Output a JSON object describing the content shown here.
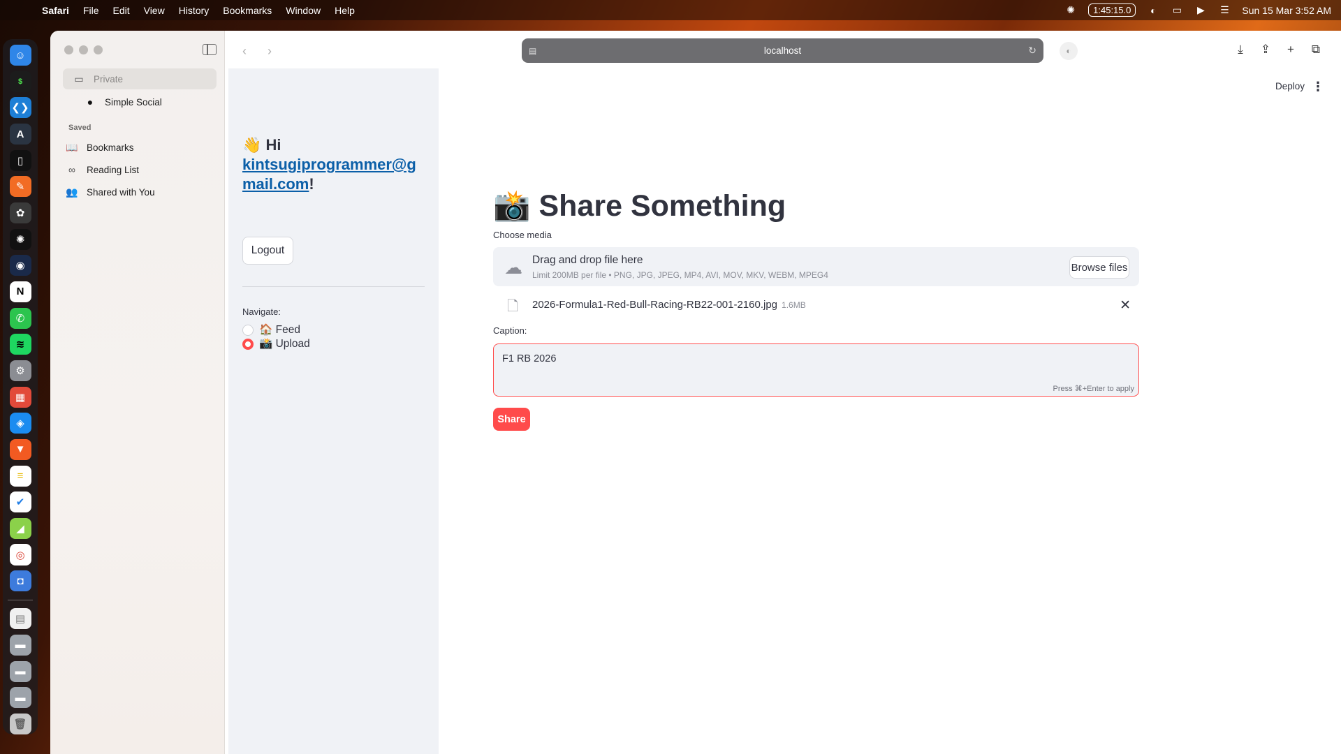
{
  "menubar": {
    "app": "Safari",
    "items": [
      "File",
      "Edit",
      "View",
      "History",
      "Bookmarks",
      "Window",
      "Help"
    ],
    "timer": "1:45:15.0",
    "datetime": "Sun 15 Mar  3:52 AM"
  },
  "browser": {
    "url": "localhost"
  },
  "sidebar": {
    "private": "Private",
    "tab": "Simple Social",
    "saved_section": "Saved",
    "items": [
      {
        "label": "Bookmarks",
        "icon": "book-icon"
      },
      {
        "label": "Reading List",
        "icon": "glasses-icon"
      },
      {
        "label": "Shared with You",
        "icon": "people-icon"
      }
    ]
  },
  "app_sidebar": {
    "greeting_prefix": "👋 Hi",
    "email": "kintsugiprogrammer@gmail.com",
    "greeting_suffix": "!",
    "logout": "Logout",
    "navigate_label": "Navigate:",
    "options": [
      {
        "label": "🏠 Feed",
        "selected": false
      },
      {
        "label": "📸 Upload",
        "selected": true
      }
    ]
  },
  "main": {
    "deploy": "Deploy",
    "title": "📸 Share Something",
    "media_label": "Choose media",
    "drop_title": "Drag and drop file here",
    "drop_limit": "Limit 200MB per file • PNG, JPG, JPEG, MP4, AVI, MOV, MKV, WEBM, MPEG4",
    "browse": "Browse files",
    "file_name": "2026-Formula1-Red-Bull-Racing-RB22-001-2160.jpg",
    "file_size": "1.6MB",
    "caption_label": "Caption:",
    "caption_value": "F1 RB 2026",
    "caption_hint": "Press ⌘+Enter to apply",
    "share": "Share"
  },
  "colors": {
    "accent": "#ff4b4b",
    "link": "#0b5fa8"
  }
}
